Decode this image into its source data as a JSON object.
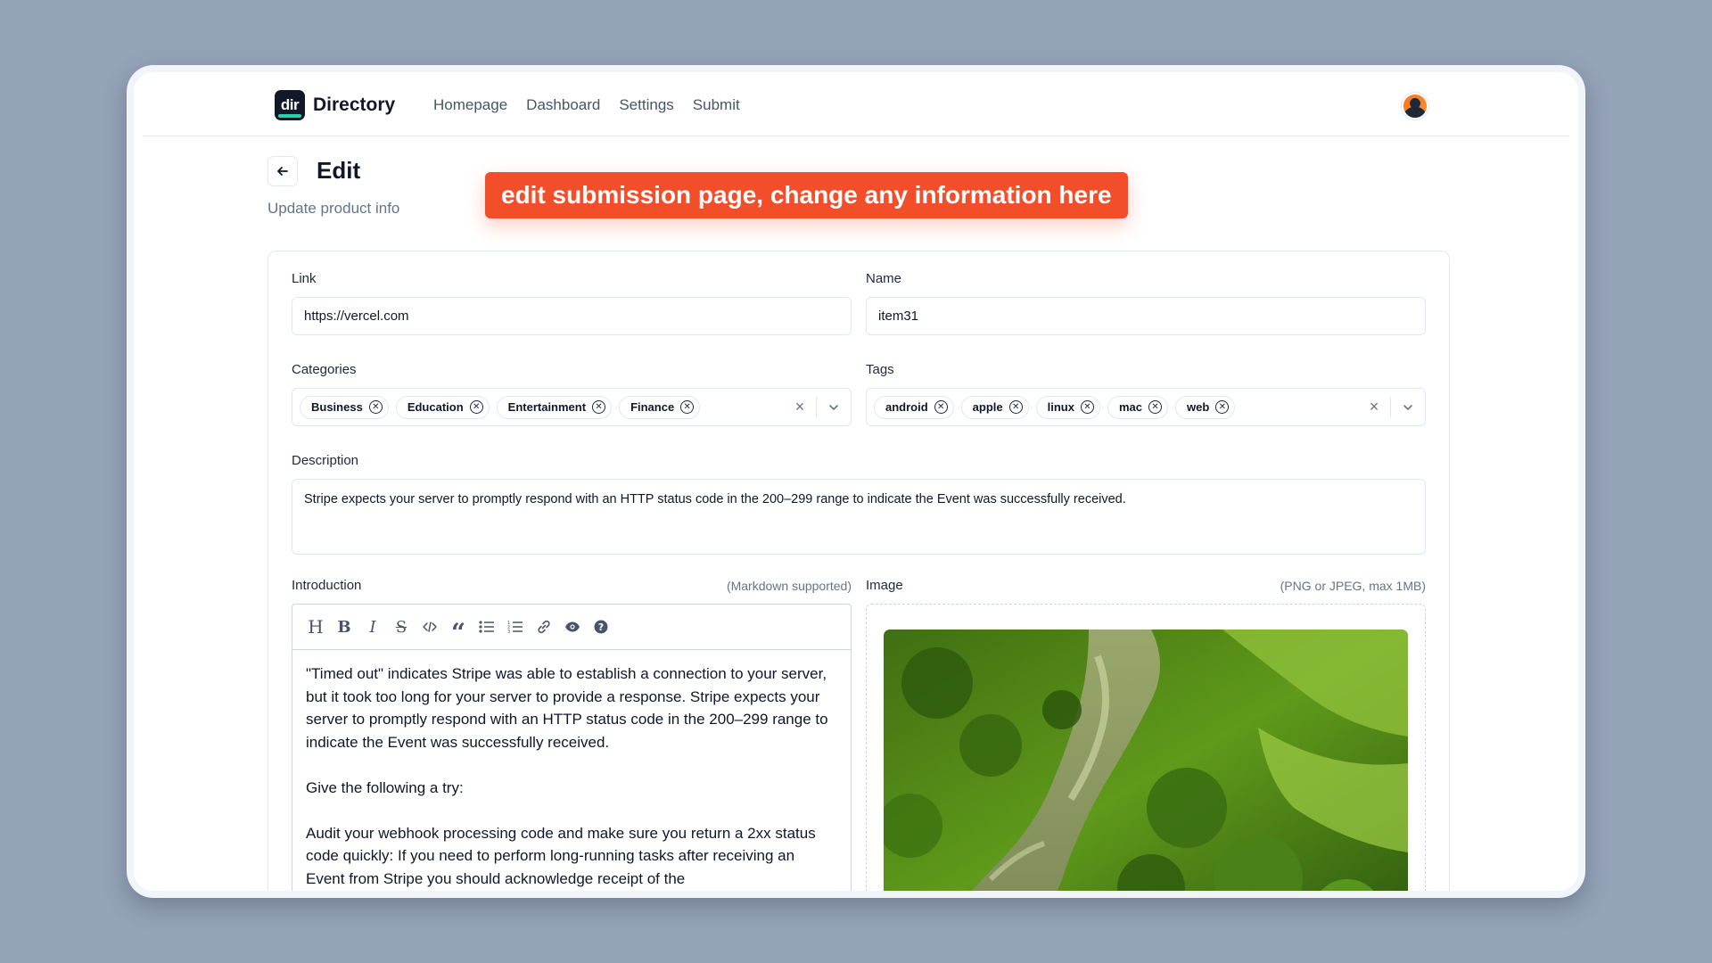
{
  "header": {
    "logo_mark": "dir",
    "logo_text": "Directory",
    "nav": [
      "Homepage",
      "Dashboard",
      "Settings",
      "Submit"
    ]
  },
  "page": {
    "title": "Edit",
    "subtitle": "Update product info",
    "callout": "edit submission page, change any information here"
  },
  "form": {
    "link": {
      "label": "Link",
      "value": "https://vercel.com"
    },
    "name": {
      "label": "Name",
      "value": "item31"
    },
    "categories": {
      "label": "Categories",
      "selected": [
        "Business",
        "Education",
        "Entertainment",
        "Finance"
      ]
    },
    "tags": {
      "label": "Tags",
      "selected": [
        "android",
        "apple",
        "linux",
        "mac",
        "web"
      ]
    },
    "description": {
      "label": "Description",
      "value": "Stripe expects your server to promptly respond with an HTTP status code in the 200–299 range to indicate the Event was successfully received."
    },
    "introduction": {
      "label": "Introduction",
      "hint": "(Markdown supported)",
      "paragraphs": [
        "\"Timed out\" indicates Stripe was able to establish a connection to your server, but it took too long for your server to provide a response. Stripe expects your server to promptly respond with an HTTP status code in the 200–299 range to indicate the Event was successfully received.",
        "Give the following a try:",
        "Audit your webhook processing code and make sure you return a 2xx status code quickly: If you need to perform long-running tasks after receiving an Event from Stripe you should acknowledge receipt of the"
      ],
      "toolbar": [
        "heading-icon",
        "bold-icon",
        "italic-icon",
        "strikethrough-icon",
        "code-icon",
        "quote-icon",
        "bullet-list-icon",
        "numbered-list-icon",
        "link-icon",
        "preview-icon",
        "help-icon"
      ]
    },
    "image": {
      "label": "Image",
      "hint": "(PNG or JPEG, max 1MB)"
    }
  },
  "colors": {
    "callout_bg": "#f24e2a",
    "background": "#94a3b8",
    "logo_accent": "#22d3aa"
  }
}
